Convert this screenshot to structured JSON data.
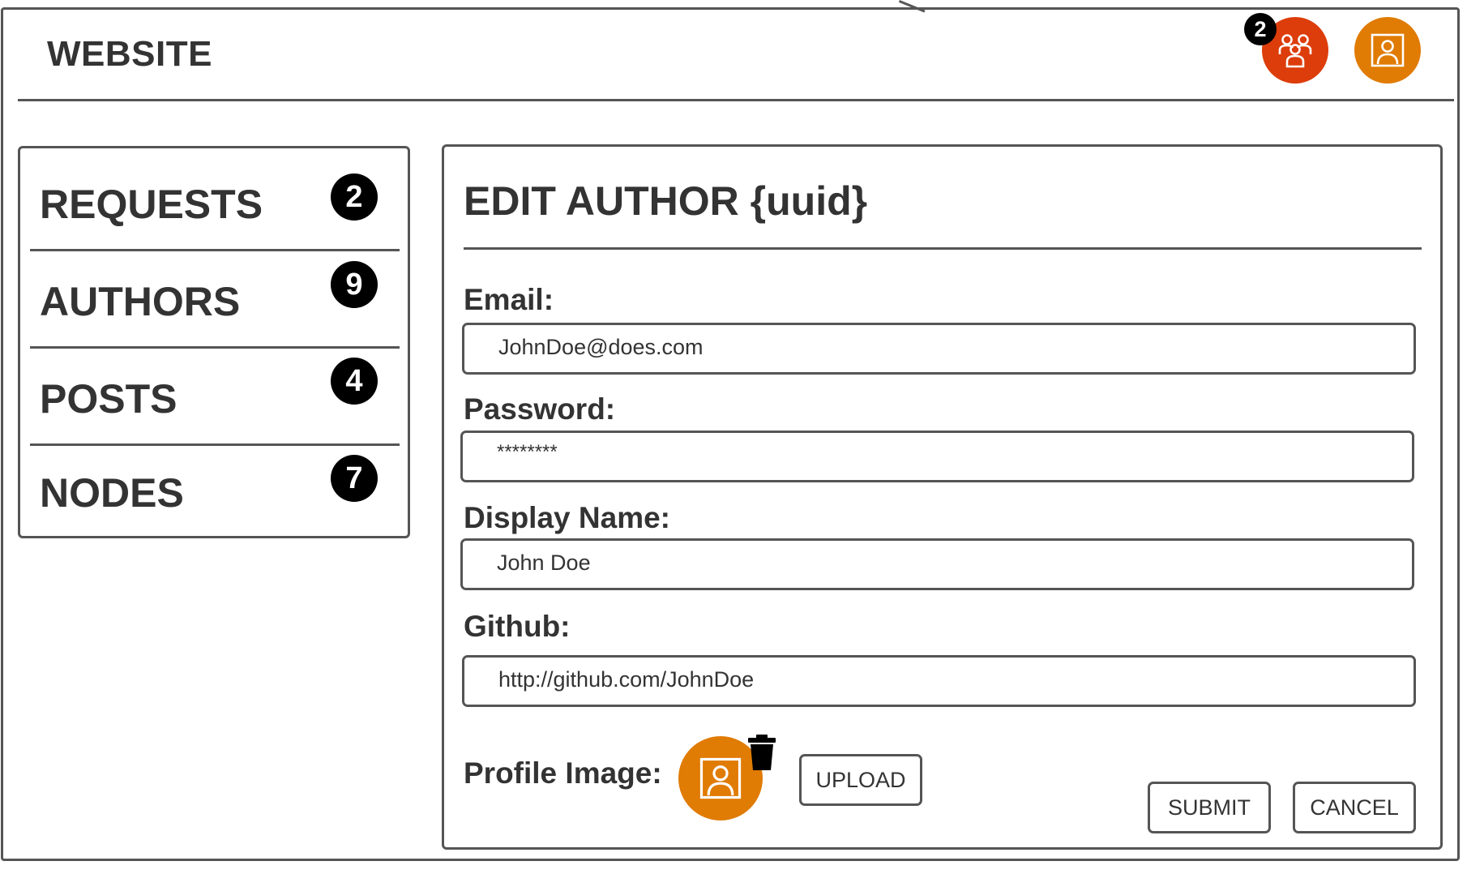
{
  "header": {
    "title": "WEBSITE",
    "friend_requests_count": "2",
    "icons": {
      "friends": "users-icon",
      "profile": "profile-icon"
    }
  },
  "sidebar": {
    "items": [
      {
        "label": "REQUESTS",
        "count": "2"
      },
      {
        "label": "AUTHORS",
        "count": "9"
      },
      {
        "label": "POSTS",
        "count": "4"
      },
      {
        "label": "NODES",
        "count": "7"
      }
    ]
  },
  "form": {
    "title": "EDIT AUTHOR {uuid}",
    "email": {
      "label": "Email:",
      "value": "JohnDoe@does.com"
    },
    "password": {
      "label": "Password:",
      "value": "********"
    },
    "display_name": {
      "label": "Display Name:",
      "value": "John Doe"
    },
    "github": {
      "label": "Github:",
      "value": "http://github.com/JohnDoe"
    },
    "profile_image": {
      "label": "Profile Image:"
    },
    "upload_label": "UPLOAD",
    "submit_label": "SUBMIT",
    "cancel_label": "CANCEL"
  },
  "colors": {
    "friends_button": "#dc3d0a",
    "profile_button": "#e07b04",
    "border": "#555555",
    "text": "#333333"
  }
}
